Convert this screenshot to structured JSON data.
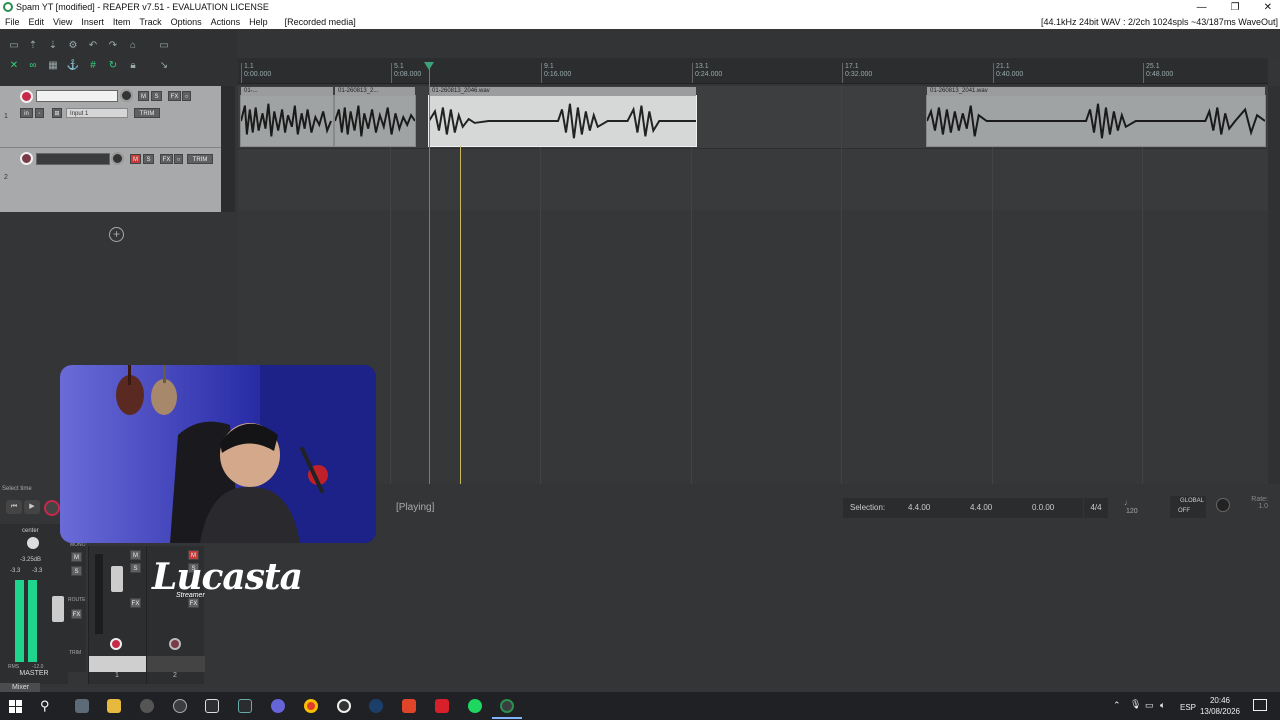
{
  "window": {
    "title": "Spam YT [modified] - REAPER v7.51 - EVALUATION LICENSE",
    "controls": [
      "—",
      "❐",
      "✕"
    ]
  },
  "menu": {
    "items": [
      "File",
      "Edit",
      "View",
      "Insert",
      "Item",
      "Track",
      "Options",
      "Actions",
      "Help"
    ],
    "recorded": "[Recorded media]",
    "audio_status": "[44.1kHz 24bit WAV : 2/2ch 1024spls ~43/187ms WaveOut]"
  },
  "ruler": {
    "marks": [
      {
        "bar": "1.1",
        "time": "0:00.000"
      },
      {
        "bar": "5.1",
        "time": "0:08.000"
      },
      {
        "bar": "9.1",
        "time": "0:16.000"
      },
      {
        "bar": "13.1",
        "time": "0:24.000"
      },
      {
        "bar": "17.1",
        "time": "0:32.000"
      },
      {
        "bar": "21.1",
        "time": "0:40.000"
      },
      {
        "bar": "25.1",
        "time": "0:48.000"
      }
    ]
  },
  "tracks": [
    {
      "number": "1",
      "input": "Input 1",
      "trim": "TRIM"
    },
    {
      "number": "2",
      "trim": "TRIM"
    }
  ],
  "items": [
    {
      "name": "01-..."
    },
    {
      "name": "01-260813_2..."
    },
    {
      "name": "01-260813_2046.wav"
    },
    {
      "name": "01-260813_2041.wav"
    }
  ],
  "transport": {
    "select_time": "Select time",
    "status": "[Playing]",
    "selection_label": "Selection:",
    "sel_start": "4.4.00",
    "sel_end": "4.4.00",
    "sel_len": "0.0.00",
    "timesig": "4/4",
    "bpm": "120",
    "global": "GLOBAL",
    "global_state": "OFF",
    "rate_label": "Rate:",
    "rate": "1.0"
  },
  "mixer": {
    "master_label": "MASTER",
    "center": "center",
    "db": "-3.25dB",
    "peak_l": "-3.3",
    "peak_r": "-3.3",
    "rms": "RMS",
    "rms_val": "-12.0",
    "tab": "Mixer",
    "mono": "MONO",
    "route": "ROUTE",
    "trim": "TRIM",
    "strip1": "1",
    "strip2": "2"
  },
  "overlay": {
    "logo": "Lucasta",
    "logo_sub": "Streamer"
  },
  "taskbar": {
    "lang": "ESP",
    "time": "20:46",
    "date": "13/08/2026"
  },
  "colors": {
    "accent_green": "#35d07f",
    "record_red": "#c62949",
    "meter_green": "#1fd48d"
  }
}
